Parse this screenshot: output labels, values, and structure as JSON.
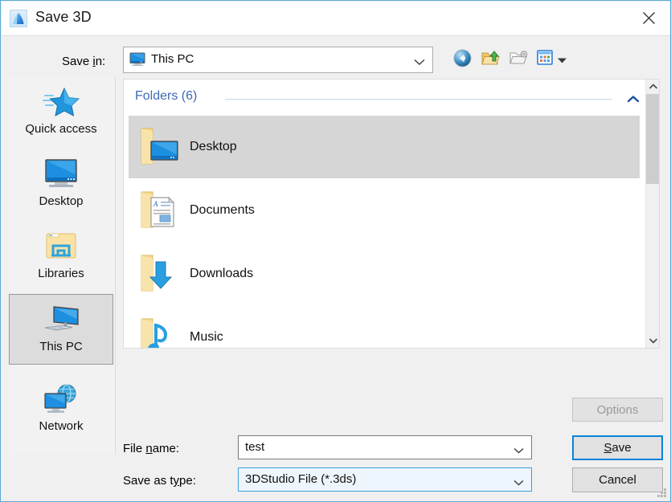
{
  "window": {
    "title": "Save 3D",
    "icon": "app-3d-icon",
    "close_label": "✕",
    "border_color": "#5aa9d6"
  },
  "savein": {
    "label_before": "Save ",
    "label_underline": "i",
    "label_after": "n:",
    "value": "This PC",
    "icon": "monitor-icon"
  },
  "toolbar": {
    "buttons": [
      {
        "name": "back-button",
        "icon": "back-arrow-icon",
        "enabled": true
      },
      {
        "name": "up-one-level-button",
        "icon": "folder-up-arrow-icon",
        "enabled": true
      },
      {
        "name": "create-new-folder-button",
        "icon": "new-folder-gear-icon",
        "enabled": false
      },
      {
        "name": "views-button",
        "icon": "views-grid-icon",
        "enabled": true
      }
    ]
  },
  "places": {
    "items": [
      {
        "label": "Quick access",
        "icon": "star-icon",
        "selected": false
      },
      {
        "label": "Desktop",
        "icon": "monitor-icon",
        "selected": false
      },
      {
        "label": "Libraries",
        "icon": "libraries-folder-icon",
        "selected": false
      },
      {
        "label": "This PC",
        "icon": "this-pc-icon",
        "selected": true
      },
      {
        "label": "Network",
        "icon": "network-globe-icon",
        "selected": false
      }
    ]
  },
  "filelist": {
    "group_title": "Folders (6)",
    "collapse_icon": "chevron-up-icon",
    "items": [
      {
        "name": "Desktop",
        "icon": "folder-desktop-icon",
        "selected": true
      },
      {
        "name": "Documents",
        "icon": "folder-documents-icon",
        "selected": false
      },
      {
        "name": "Downloads",
        "icon": "folder-downloads-icon",
        "selected": false
      },
      {
        "name": "Music",
        "icon": "folder-music-icon",
        "selected": false
      }
    ],
    "scrollbar": {
      "up_icon": "chevron-up-icon",
      "down_icon": "chevron-down-icon"
    }
  },
  "form": {
    "filename": {
      "label_before": "File ",
      "label_underline": "n",
      "label_after": "ame:",
      "value": "test",
      "placeholder": ""
    },
    "savetype": {
      "label_before": "Save as t",
      "label_underline": "y",
      "label_after": "pe:",
      "value": "3DStudio File (*.3ds)",
      "options": [
        "3DStudio File (*.3ds)"
      ]
    }
  },
  "buttons": {
    "options": {
      "label": "Options",
      "enabled": false
    },
    "save": {
      "label_before": "",
      "label_underline": "S",
      "label_after": "ave",
      "default": true
    },
    "cancel": {
      "label": "Cancel"
    }
  },
  "colors": {
    "accent_blue": "#0a84d8",
    "group_header": "#3d6ab5",
    "selection_gray": "#d6d6d6",
    "folder_yellow": "#f6d27a"
  }
}
